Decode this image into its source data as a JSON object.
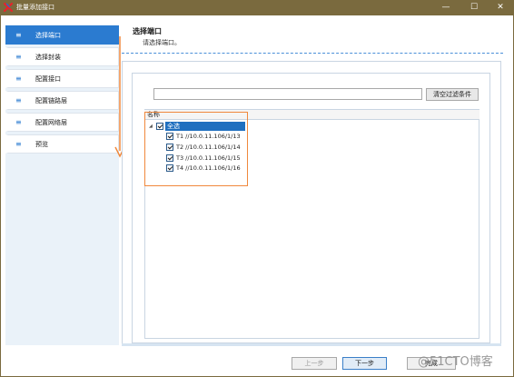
{
  "window": {
    "title": "批量添加接口",
    "minimize": "—",
    "maximize": "☐",
    "close": "✕",
    "titlebar_color": "#7a6a3e"
  },
  "sidebar": {
    "items": [
      {
        "label": "选择端口",
        "active": true
      },
      {
        "label": "选择封装",
        "active": false
      },
      {
        "label": "配置接口",
        "active": false
      },
      {
        "label": "配置链路层",
        "active": false
      },
      {
        "label": "配置网络层",
        "active": false
      },
      {
        "label": "预览",
        "active": false
      }
    ],
    "bullet": "≡",
    "accent": "#2b7bd0"
  },
  "header": {
    "title": "选择端口",
    "subtitle": "请选择端口。"
  },
  "filter": {
    "value": "",
    "button_label": "清空过滤条件"
  },
  "list": {
    "column": "名称",
    "root": {
      "label": "全选",
      "checked": true
    },
    "items": [
      {
        "label": "T1 //10.0.11.106/1/13",
        "checked": true
      },
      {
        "label": "T2 //10.0.11.106/1/14",
        "checked": true
      },
      {
        "label": "T3 //10.0.11.106/1/15",
        "checked": true
      },
      {
        "label": "T4 //10.0.11.106/1/16",
        "checked": true
      }
    ]
  },
  "footer": {
    "prev_label": "上一步",
    "next_label": "下一步",
    "done_label": "完成"
  },
  "watermark": "@51CTO博客",
  "highlight_color": "#f0883c"
}
